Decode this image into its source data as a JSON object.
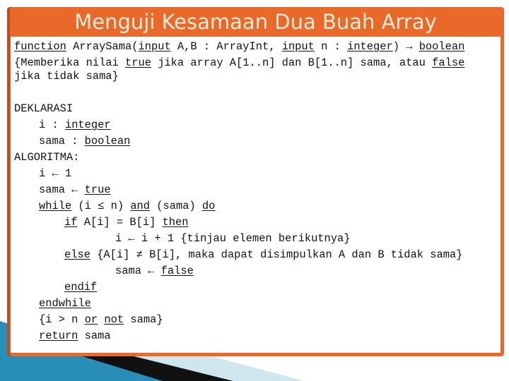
{
  "slide": {
    "title": "Menguji Kesamaan Dua Buah Array",
    "colors": {
      "frame": "#E8692A",
      "title_text": "#FCEBD6",
      "accent_blue": "#2A8FB8"
    },
    "lines": [
      {
        "indent": 0,
        "segments": [
          {
            "t": "function",
            "u": true
          },
          {
            "t": " ArraySama(",
            "u": false
          },
          {
            "t": "input",
            "u": true
          },
          {
            "t": " A,B : ArrayInt, ",
            "u": false
          },
          {
            "t": "input",
            "u": true
          },
          {
            "t": " n : ",
            "u": false
          },
          {
            "t": "integer",
            "u": true
          },
          {
            "t": ") → ",
            "u": false
          },
          {
            "t": "boolean",
            "u": true
          }
        ]
      },
      {
        "indent": 0,
        "segments": [
          {
            "t": "{Memberika nilai ",
            "u": false
          },
          {
            "t": "true",
            "u": true
          },
          {
            "t": " jika array A[1..n] dan B[1..n] sama, atau ",
            "u": false
          },
          {
            "t": "false",
            "u": true
          }
        ]
      },
      {
        "indent": 0,
        "segments": [
          {
            "t": "jika tidak sama}",
            "u": false
          }
        ]
      },
      {
        "indent": 0,
        "segments": [
          {
            "t": "DEKLARASI",
            "u": false
          }
        ]
      },
      {
        "indent": 1,
        "segments": [
          {
            "t": "i : ",
            "u": false
          },
          {
            "t": "integer",
            "u": true
          }
        ]
      },
      {
        "indent": 1,
        "segments": [
          {
            "t": "sama : ",
            "u": false
          },
          {
            "t": "boolean",
            "u": true
          }
        ]
      },
      {
        "indent": 0,
        "segments": [
          {
            "t": "ALGORITMA:",
            "u": false
          }
        ]
      },
      {
        "indent": 1,
        "segments": [
          {
            "t": "i ← 1",
            "u": false
          }
        ]
      },
      {
        "indent": 1,
        "segments": [
          {
            "t": "sama ← ",
            "u": false
          },
          {
            "t": "true",
            "u": true
          }
        ]
      },
      {
        "indent": 1,
        "segments": [
          {
            "t": "while",
            "u": true
          },
          {
            "t": " (i ≤ n) ",
            "u": false
          },
          {
            "t": "and",
            "u": true
          },
          {
            "t": " (sama) ",
            "u": false
          },
          {
            "t": "do",
            "u": true
          }
        ]
      },
      {
        "indent": 2,
        "segments": [
          {
            "t": "if",
            "u": true
          },
          {
            "t": " A[i] = B[i] ",
            "u": false
          },
          {
            "t": "then",
            "u": true
          }
        ]
      },
      {
        "indent": 3,
        "segments": [
          {
            "t": "i ← i + 1 {tinjau elemen berikutnya}",
            "u": false
          }
        ]
      },
      {
        "indent": 2,
        "segments": [
          {
            "t": "else",
            "u": true
          },
          {
            "t": " {A[i] ≠ B[i], maka dapat disimpulkan A dan B tidak sama}",
            "u": false
          }
        ]
      },
      {
        "indent": 3,
        "segments": [
          {
            "t": "sama ← ",
            "u": false
          },
          {
            "t": "false",
            "u": true
          }
        ]
      },
      {
        "indent": 2,
        "segments": [
          {
            "t": "endif",
            "u": true
          }
        ]
      },
      {
        "indent": 1,
        "segments": [
          {
            "t": "endwhile",
            "u": true
          }
        ]
      },
      {
        "indent": 1,
        "segments": [
          {
            "t": "{i > n ",
            "u": false
          },
          {
            "t": "or",
            "u": true
          },
          {
            "t": " ",
            "u": false
          },
          {
            "t": "not",
            "u": true
          },
          {
            "t": " sama}",
            "u": false
          }
        ]
      },
      {
        "indent": 1,
        "segments": [
          {
            "t": "return",
            "u": true
          },
          {
            "t": " sama",
            "u": false
          }
        ]
      }
    ]
  }
}
